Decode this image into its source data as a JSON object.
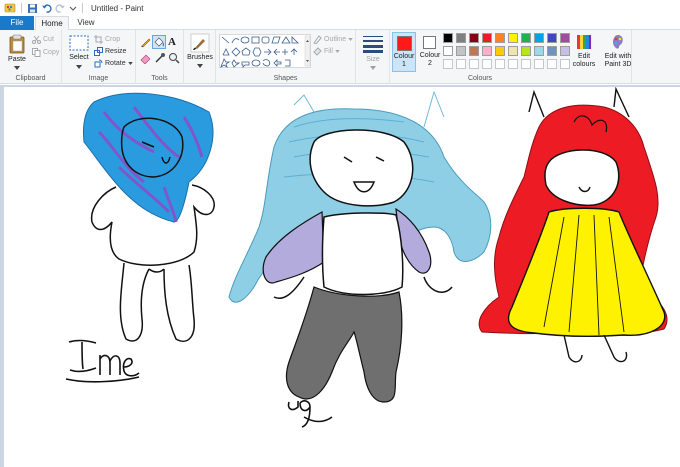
{
  "window": {
    "title": "Untitled - Paint"
  },
  "tabs": [
    {
      "label": "File"
    },
    {
      "label": "Home"
    },
    {
      "label": "View"
    }
  ],
  "clipboard": {
    "paste": "Paste",
    "cut": "Cut",
    "copy": "Copy",
    "label": "Clipboard"
  },
  "image": {
    "select": "Select",
    "crop": "Crop",
    "resize": "Resize",
    "rotate": "Rotate",
    "label": "Image"
  },
  "tools": {
    "label": "Tools",
    "brushes": "Brushes"
  },
  "shapes": {
    "outline": "Outline",
    "fill": "Fill",
    "label": "Shapes"
  },
  "size": {
    "label": "Size"
  },
  "colours": {
    "colour1": "Colour",
    "colour1_num": "1",
    "colour2": "Colour",
    "colour2_num": "2",
    "edit": "Edit",
    "edit2": "colours",
    "paint3d": "Edit with",
    "paint3d2": "Paint 3D",
    "label": "Colours",
    "primary": "#ff1a1a",
    "secondary": "#ffffff",
    "palette_row1": [
      "#000000",
      "#7f7f7f",
      "#880015",
      "#ed1c24",
      "#ff7f27",
      "#fff200",
      "#22b14c",
      "#00a2e8",
      "#3f48cc",
      "#a349a4"
    ],
    "palette_row2": [
      "#ffffff",
      "#c3c3c3",
      "#b97a57",
      "#ffaec9",
      "#ffc90e",
      "#efe4b0",
      "#b5e61d",
      "#99d9ea",
      "#7092be",
      "#c8bfe7"
    ]
  },
  "canvas": {
    "label_me": "me",
    "label_u": "ug",
    "colors": {
      "hair_blue": "#2b9be0",
      "hair_purple": "#8a4fc8",
      "hair_light": "#8ecfe6",
      "jacket": "#b3abdc",
      "pants": "#6f6f6f",
      "red": "#ed1c24",
      "yellow": "#fff200"
    }
  }
}
